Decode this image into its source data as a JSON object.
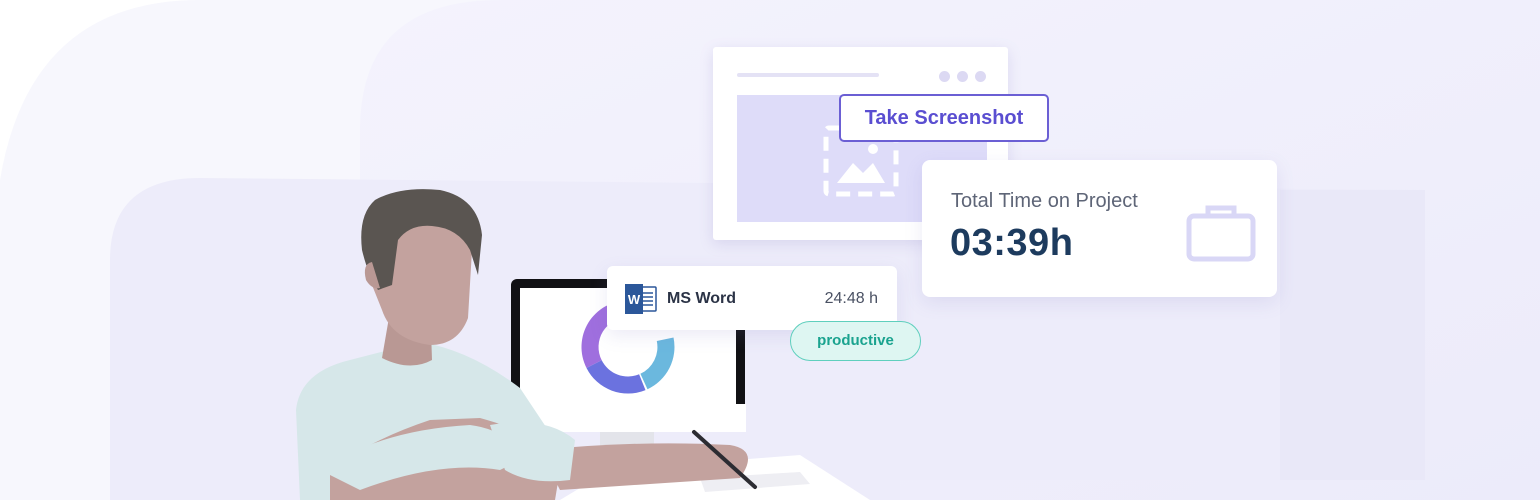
{
  "screenshot_widget": {
    "button_label": "Take Screenshot",
    "icon": "image-icon"
  },
  "time_card": {
    "label": "Total Time on Project",
    "value": "03:39h",
    "icon": "briefcase-icon"
  },
  "app_usage": {
    "app_name": "MS Word",
    "duration": "24:48 h",
    "icon": "ms-word-icon",
    "status_badge": "productive"
  },
  "monitor": {
    "donut_chart": "donut-chart",
    "segment_colors": [
      "#9f6fde",
      "#6b72df",
      "#6bb8de"
    ]
  },
  "colors": {
    "accent": "#6b5fd4",
    "productive": "#1aa38f",
    "time_value": "#1d3b5e",
    "background_tint": "#efeefb"
  }
}
